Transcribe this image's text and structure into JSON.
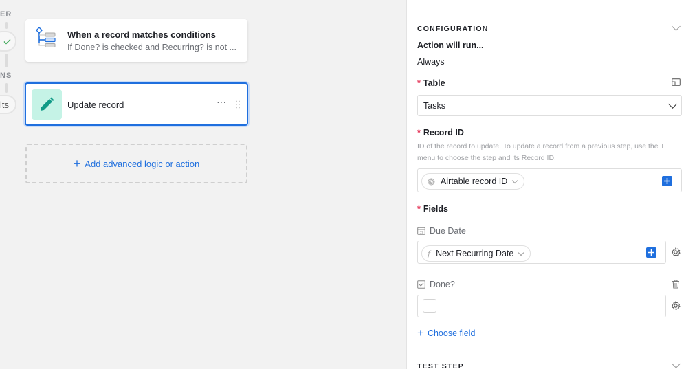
{
  "canvas": {
    "rail": {
      "trigger_label_fragment": "ER",
      "actions_label_fragment": "NS",
      "results_pill_fragment": "lts"
    },
    "trigger_card": {
      "title": "When a record matches conditions",
      "subtitle": "If Done? is checked and Recurring? is not ..."
    },
    "action_card": {
      "title": "Update record",
      "more_label": "···"
    },
    "add_step": {
      "plus": "+",
      "label": "Add advanced logic or action"
    }
  },
  "panel": {
    "configuration": {
      "heading": "CONFIGURATION",
      "run_label": "Action will run...",
      "run_value": "Always",
      "required_marker": "*",
      "table": {
        "label": "Table",
        "value": "Tasks"
      },
      "record_id": {
        "label": "Record ID",
        "help": "ID of the record to update. To update a record from a previous step, use the + menu to choose the step and its Record ID.",
        "token": "Airtable record ID"
      },
      "fields": {
        "label": "Fields",
        "items": [
          {
            "name": "Due Date",
            "icon": "calendar-icon",
            "token": "Next Recurring Date",
            "token_icon": "formula-icon"
          },
          {
            "name": "Done?",
            "icon": "checkbox-icon",
            "checked": false
          }
        ],
        "choose_plus": "+",
        "choose_label": "Choose field"
      }
    },
    "test_step": {
      "heading": "TEST STEP"
    }
  },
  "colors": {
    "accent": "#1f6fde",
    "required": "#e3294e",
    "action_tile": "#c5f3e6",
    "action_icon": "#0f9a86"
  }
}
